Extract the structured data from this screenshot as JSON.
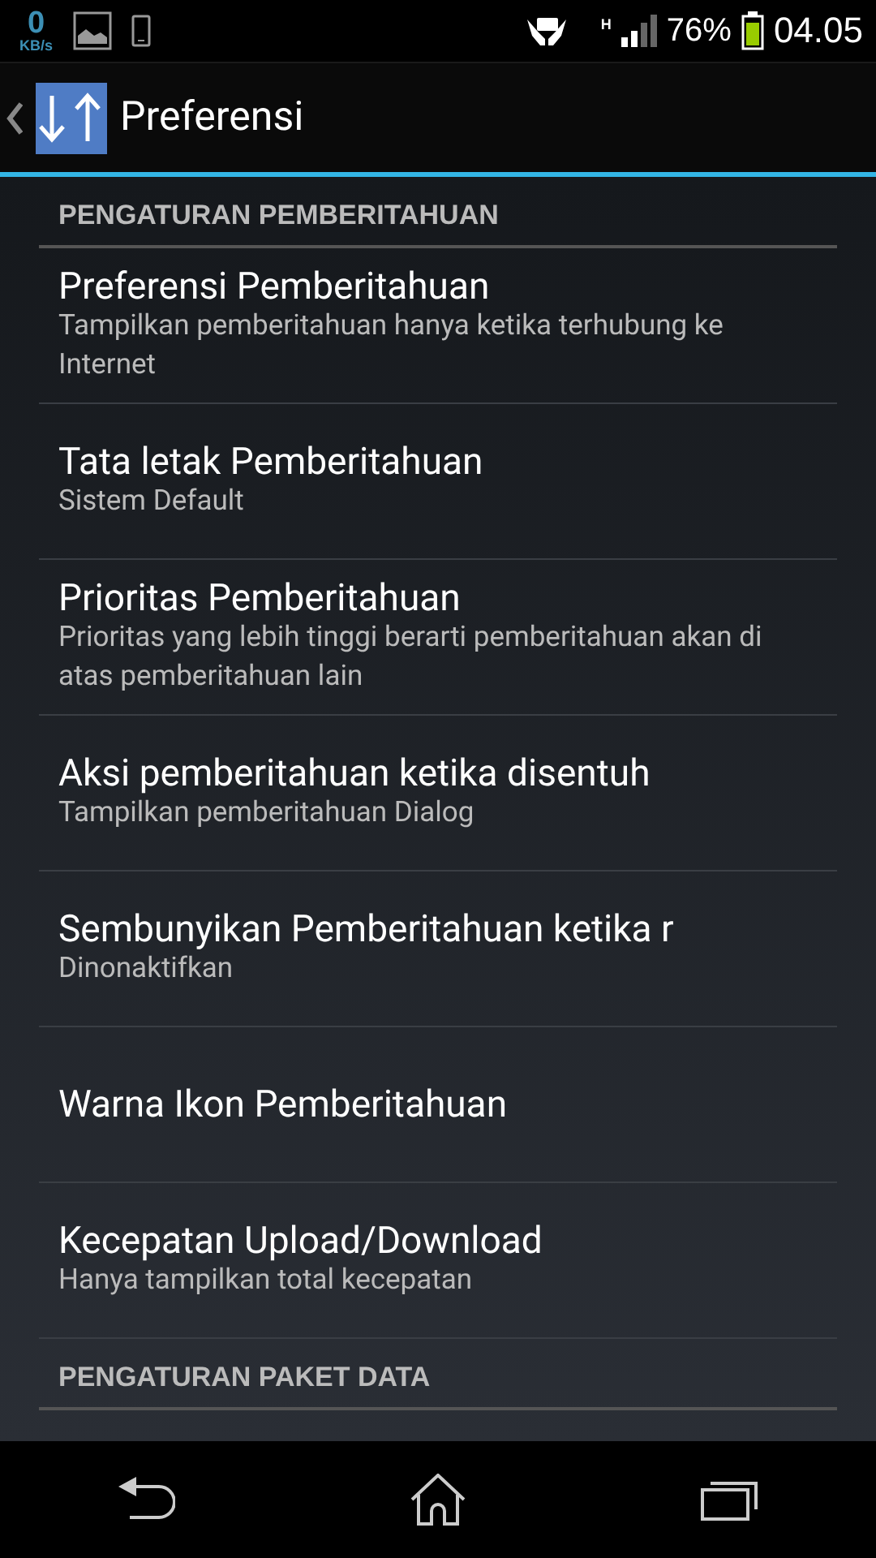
{
  "status_bar": {
    "speed_value": "0",
    "speed_unit": "KB/s",
    "network_type": "H",
    "battery": "76%",
    "time": "04.05"
  },
  "action_bar": {
    "title": "Preferensi"
  },
  "sections": [
    {
      "header": "PENGATURAN PEMBERITAHUAN",
      "items": [
        {
          "title": "Preferensi Pemberitahuan",
          "summary": "Tampilkan pemberitahuan hanya ketika terhubung ke Internet"
        },
        {
          "title": "Tata letak Pemberitahuan",
          "summary": "Sistem Default"
        },
        {
          "title": "Prioritas Pemberitahuan",
          "summary": "Prioritas yang lebih tinggi berarti pemberitahuan akan di atas pemberitahuan lain"
        },
        {
          "title": "Aksi pemberitahuan ketika disentuh",
          "summary": "Tampilkan pemberitahuan Dialog"
        },
        {
          "title": "Sembunyikan Pemberitahuan ketika r",
          "summary": "Dinonaktifkan"
        },
        {
          "title": "Warna Ikon Pemberitahuan"
        },
        {
          "title": "Kecepatan Upload/Download",
          "summary": "Hanya tampilkan total kecepatan"
        }
      ]
    },
    {
      "header": "PENGATURAN PAKET DATA"
    }
  ]
}
